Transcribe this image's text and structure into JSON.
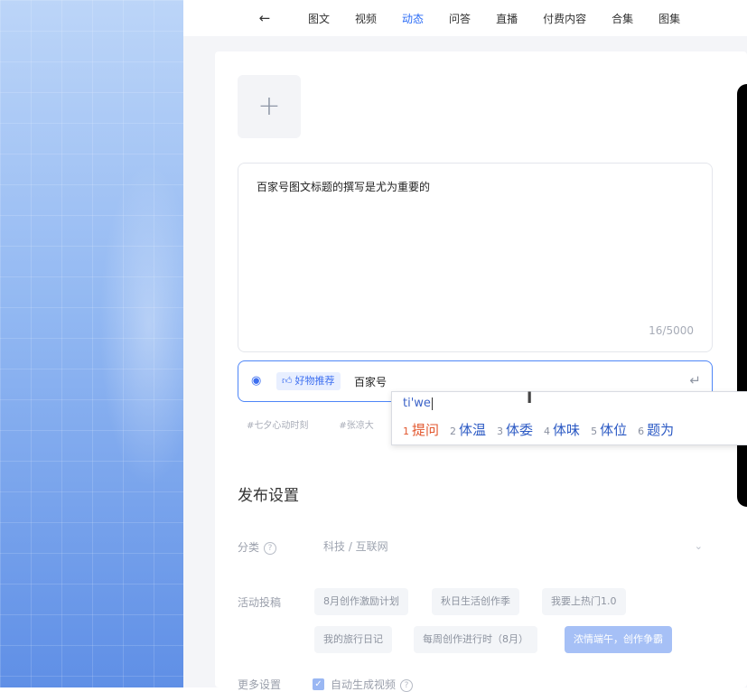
{
  "nav": {
    "back_icon": "arrow-left-icon",
    "tabs": [
      {
        "label": "图文",
        "active": false
      },
      {
        "label": "视频",
        "active": false
      },
      {
        "label": "动态",
        "active": true
      },
      {
        "label": "问答",
        "active": false
      },
      {
        "label": "直播",
        "active": false
      },
      {
        "label": "付费内容",
        "active": false
      },
      {
        "label": "合集",
        "active": false
      },
      {
        "label": "图集",
        "active": false
      }
    ]
  },
  "editor": {
    "upload_plus": "+",
    "content": "百家号图文标题的撰写是尤为重要的",
    "counter": "16/5000"
  },
  "topic_bar": {
    "tag_label": "好物推荐",
    "typed_text": "百家号",
    "icons": [
      "face-icon",
      "thumb-up-icon",
      "enter-icon"
    ]
  },
  "hashtags": [
    "#七夕心动时刻",
    "#张凉大"
  ],
  "ime": {
    "pinyin": "ti'we",
    "candidates": [
      {
        "num": "1",
        "text": "提问"
      },
      {
        "num": "2",
        "text": "体温"
      },
      {
        "num": "3",
        "text": "体委"
      },
      {
        "num": "4",
        "text": "体味"
      },
      {
        "num": "5",
        "text": "体位"
      },
      {
        "num": "6",
        "text": "题为"
      }
    ]
  },
  "settings": {
    "title": "发布设置",
    "category_label": "分类",
    "category_value": "科技 / 互联网",
    "activity_label": "活动投稿",
    "activities": [
      {
        "label": "8月创作激励计划",
        "selected": false
      },
      {
        "label": "秋日生活创作季",
        "selected": false
      },
      {
        "label": "我要上热门1.0",
        "selected": false
      },
      {
        "label": "我的旅行日记",
        "selected": false
      },
      {
        "label": "每周创作进行时（8月）",
        "selected": false
      },
      {
        "label": "浓情端午，创作争霸",
        "selected": true
      }
    ],
    "more_label": "更多设置",
    "auto_label": "自动生成视频"
  },
  "colors": {
    "accent": "#2b6cf6",
    "ime_first": "#e2562d",
    "ime_candidate": "#2c5ac4"
  }
}
